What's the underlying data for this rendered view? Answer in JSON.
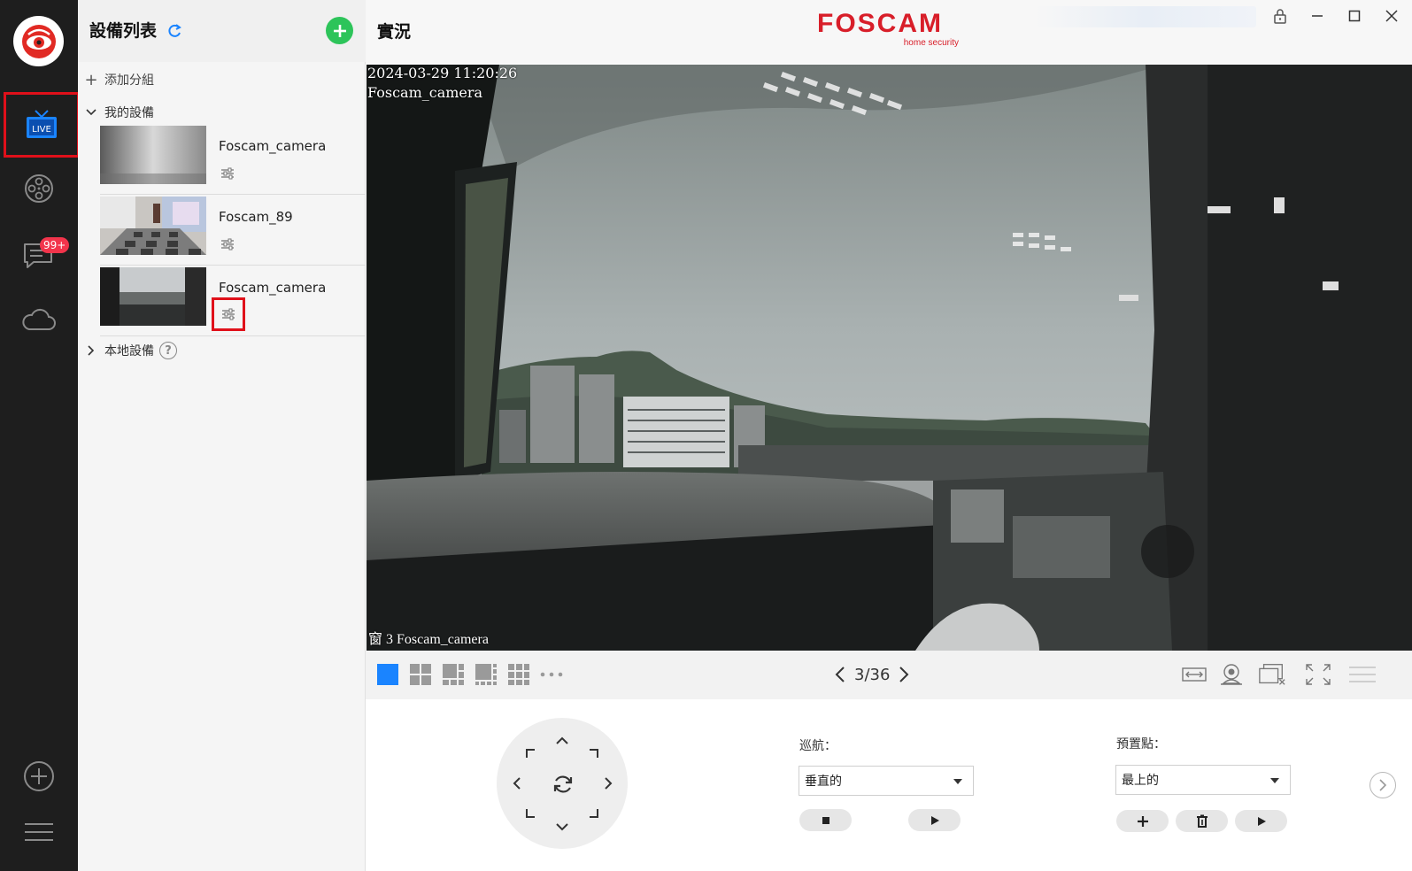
{
  "sidebar": {
    "badge": "99+",
    "items": [
      {
        "icon": "live-tv-icon",
        "label": "LIVE"
      },
      {
        "icon": "playback-reel-icon"
      },
      {
        "icon": "message-icon"
      },
      {
        "icon": "cloud-icon"
      },
      {
        "icon": "add-circle-icon"
      },
      {
        "icon": "menu-icon"
      }
    ]
  },
  "device_panel": {
    "title": "設備列表",
    "add_group": "添加分組",
    "my_devices": "我的設備",
    "devices": [
      {
        "name": "Foscam_camera"
      },
      {
        "name": "Foscam_89"
      },
      {
        "name": "Foscam_camera"
      }
    ],
    "local_devices": "本地設備",
    "help": "?"
  },
  "main": {
    "title": "實況",
    "brand": "FOSCAM",
    "brand_sub": "home security",
    "video": {
      "timestamp": "2024-03-29 11:20:26",
      "camera_osd": "Foscam_camera",
      "window_label": "窗 3 Foscam_camera"
    },
    "pager": {
      "current": "3",
      "sep": "/",
      "total": "36"
    },
    "cruise": {
      "label": "巡航：",
      "value": "垂直的"
    },
    "preset": {
      "label": "預置點：",
      "value": "最上的"
    }
  },
  "colors": {
    "accent": "#1a84ff",
    "add_green": "#2dc45a",
    "brand_red": "#d81e29",
    "highlight": "#e0101a",
    "rail_bg": "#1e1e1e"
  }
}
